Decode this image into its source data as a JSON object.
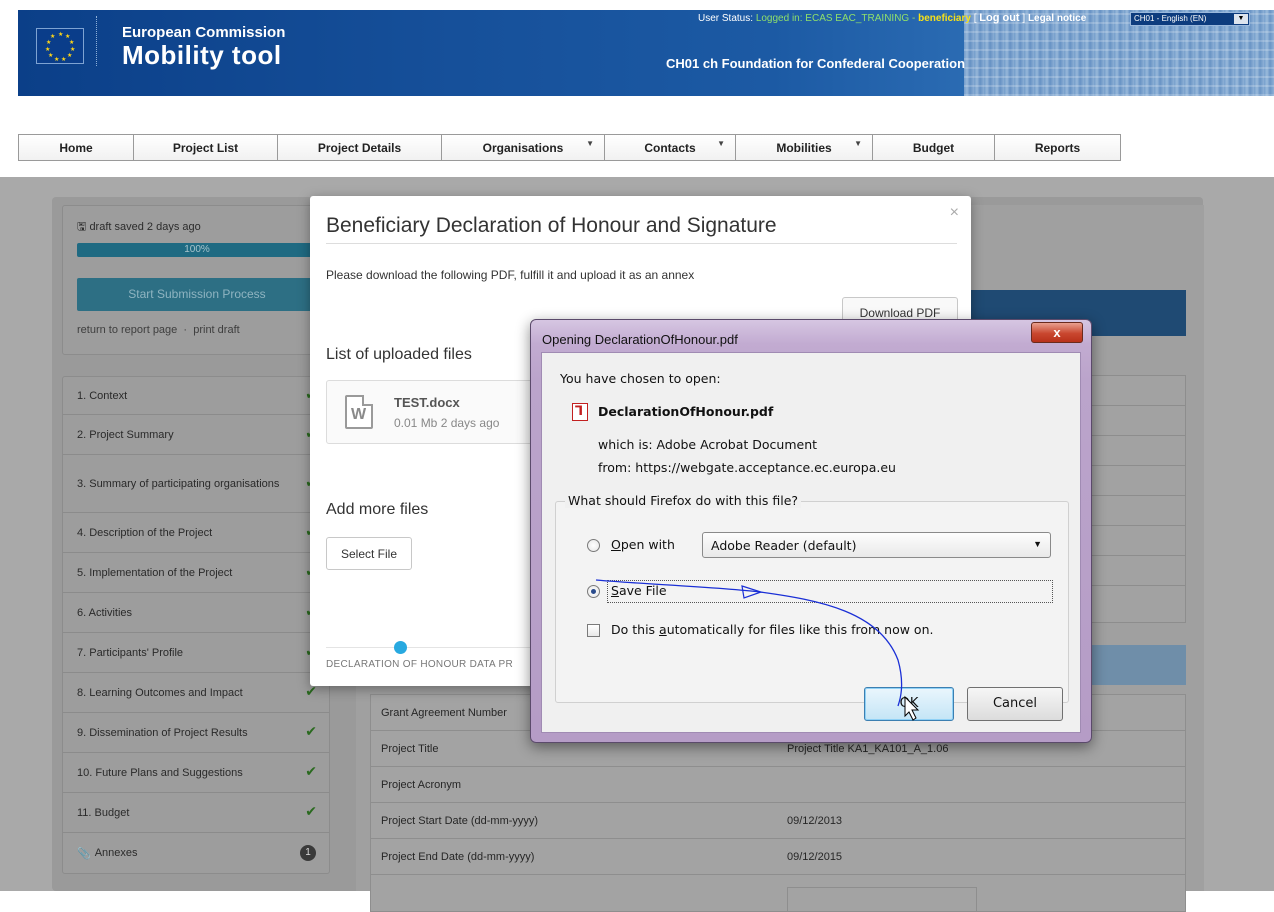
{
  "header": {
    "user_status_label": "User Status:",
    "user_status_value": "Logged in: ECAS EAC_TRAINING - ",
    "user_role": "beneficiary",
    "bracket_open": "[",
    "logout": "Log out",
    "bracket_close": "]",
    "legal_notice": "Legal notice",
    "language": "CH01 - English (EN)",
    "ec_title": "European Commission",
    "tool_title": "Mobility tool",
    "organisation": "CH01 ch Foundation for Confederal Cooperation"
  },
  "nav": [
    {
      "label": "Home",
      "dropdown": false
    },
    {
      "label": "Project List",
      "dropdown": false
    },
    {
      "label": "Project Details",
      "dropdown": false
    },
    {
      "label": "Organisations",
      "dropdown": true
    },
    {
      "label": "Contacts",
      "dropdown": true
    },
    {
      "label": "Mobilities",
      "dropdown": true
    },
    {
      "label": "Budget",
      "dropdown": false
    },
    {
      "label": "Reports",
      "dropdown": false
    }
  ],
  "draft": {
    "saved_text": "draft saved 2 days ago",
    "progress_label": "100%",
    "progress": 1.0,
    "submit_label": "Start Submission Process",
    "return_link": "return to report page",
    "separator": "·",
    "print_link": "print draft"
  },
  "sidemenu": [
    {
      "label": "1. Context",
      "status": "check"
    },
    {
      "label": "2. Project Summary",
      "status": "check"
    },
    {
      "label": "3. Summary of participating organisations",
      "status": "check"
    },
    {
      "label": "4. Description of the Project",
      "status": "check"
    },
    {
      "label": "5. Implementation of the Project",
      "status": "check"
    },
    {
      "label": "6. Activities",
      "status": "check"
    },
    {
      "label": "7. Participants' Profile",
      "status": "check"
    },
    {
      "label": "8. Learning Outcomes and Impact",
      "status": "check"
    },
    {
      "label": "9. Dissemination of Project Results",
      "status": "check"
    },
    {
      "label": "10. Future Plans and Suggestions",
      "status": "check"
    },
    {
      "label": "11. Budget",
      "status": "check"
    },
    {
      "label": "Annexes",
      "status": "badge",
      "badge": "1"
    }
  ],
  "info_table": [
    {
      "label": "Grant Agreement Number",
      "value": ""
    },
    {
      "label": "Project Title",
      "value": "Project Title KA1_KA101_A_1.06"
    },
    {
      "label": "Project Acronym",
      "value": ""
    },
    {
      "label": "Project Start Date (dd-mm-yyyy)",
      "value": "09/12/2013"
    },
    {
      "label": "Project End Date (dd-mm-yyyy)",
      "value": "09/12/2015"
    }
  ],
  "modal": {
    "title": "Beneficiary Declaration of Honour and Signature",
    "close": "×",
    "description": "Please download the following PDF, fulfill it and upload it as an annex",
    "download_label": "Download PDF",
    "list_heading": "List of uploaded files",
    "file": {
      "icon_letter": "W",
      "name": "TEST.docx",
      "size": "0.01 Mb",
      "age": "2 days ago"
    },
    "add_heading": "Add more files",
    "select_label": "Select File",
    "step_label": "DECLARATION OF HONOUR DATA PR"
  },
  "dialog": {
    "title": "Opening DeclarationOfHonour.pdf",
    "close": "x",
    "chosen_text": "You have chosen to open:",
    "file_name": "DeclarationOfHonour.pdf",
    "which_is": "which is:  Adobe Acrobat Document",
    "from": "from:  https://webgate.acceptance.ec.europa.eu",
    "question": "What should Firefox do with this file?",
    "open_with_pre": "",
    "open_with_u": "O",
    "open_with_post": "pen with",
    "open_with_app": "Adobe Reader  (default)",
    "save_u": "S",
    "save_post": "ave File",
    "auto_pre": "Do this ",
    "auto_u": "a",
    "auto_post": "utomatically for files like this from now on.",
    "ok_label": "OK",
    "cancel_label": "Cancel",
    "selected_option": "save"
  },
  "colors": {
    "nav_border": "#9a9a9a",
    "progress": "#1f6a82",
    "check": "#2a6a1f",
    "step_dot": "#28a9e0",
    "annotation": "#1a2fd6"
  }
}
